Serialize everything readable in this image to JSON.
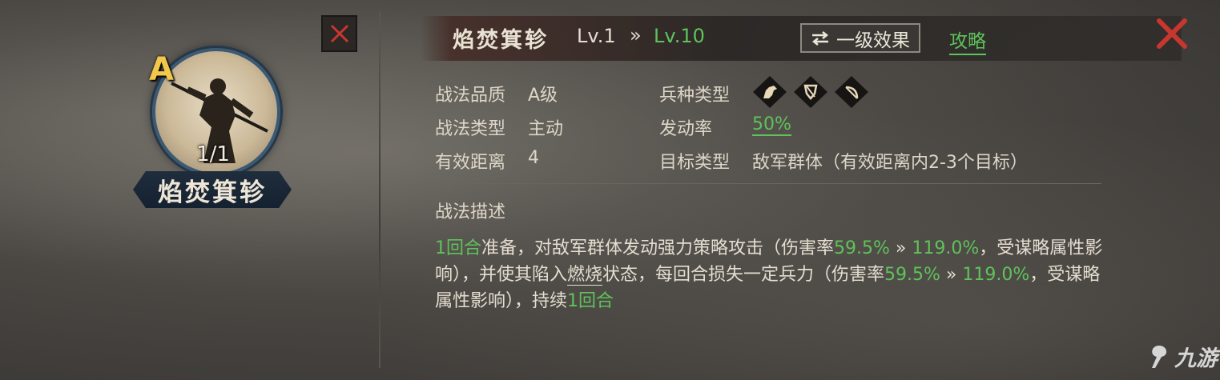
{
  "skill": {
    "name": "焰焚箕轸",
    "grade": "A",
    "count": "1/1"
  },
  "header": {
    "title": "焰焚箕轸",
    "level_from": "Lv.1",
    "level_arrow": "»",
    "level_to": "Lv.10",
    "effect_button": "一级效果",
    "guide_link": "攻略"
  },
  "attributes": {
    "quality_label": "战法品质",
    "quality_value": "A级",
    "type_label": "战法类型",
    "type_value": "主动",
    "range_label": "有效距离",
    "range_value": "4",
    "troop_label": "兵种类型",
    "rate_label": "发动率",
    "rate_value": "50%",
    "target_label": "目标类型",
    "target_value": "敌军群体（有效距离内2-3个目标）"
  },
  "troop_types": [
    "cavalry-icon",
    "shield-icon",
    "bow-icon"
  ],
  "description": {
    "title": "战法描述",
    "p1": "1回合",
    "p2": "准备，对敌军群体发动强力策略攻击（伤害率",
    "p3": "59.5%",
    "p4": " » ",
    "p5": "119.0%",
    "p6": "，受谋略属性影响），并使其陷入",
    "p7": "燃烧",
    "p8": "状态，每回合损失一定兵力（伤害率",
    "p9": "59.5%",
    "p10": " » ",
    "p11": "119.0%",
    "p12": "，受谋略属性影响），持续",
    "p13": "1回合"
  },
  "watermark": "九游",
  "colors": {
    "accent_green": "#5fc25a",
    "grade_gold": "#f1c84a",
    "close_red": "#c8372e"
  }
}
